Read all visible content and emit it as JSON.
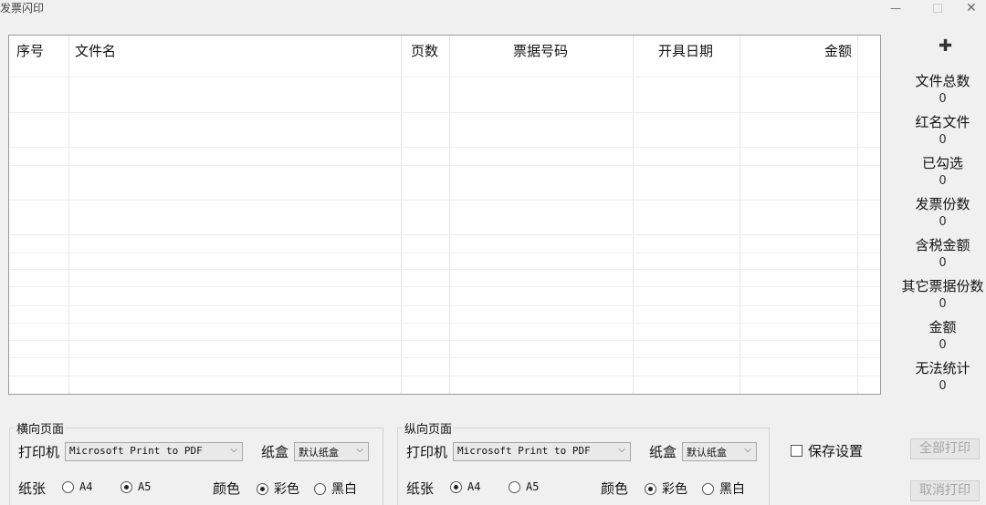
{
  "window": {
    "title": "发票闪印",
    "minimize": "—",
    "close": "✕"
  },
  "grid": {
    "columns": [
      "序号",
      "文件名",
      "页数",
      "票据号码",
      "开具日期",
      "金额"
    ]
  },
  "toolbar": {
    "add_icon": "plus-icon",
    "add_glyph": "✚"
  },
  "stats": [
    {
      "label": "文件总数",
      "value": "0"
    },
    {
      "label": "红名文件",
      "value": "0"
    },
    {
      "label": "已勾选",
      "value": "0"
    },
    {
      "label": "发票份数",
      "value": "0"
    },
    {
      "label": "含税金额",
      "value": "0"
    },
    {
      "label": "其它票据份数",
      "value": "0"
    },
    {
      "label": "金额",
      "value": "0"
    },
    {
      "label": "无法统计",
      "value": "0"
    }
  ],
  "landscape": {
    "title": "横向页面",
    "printer_label": "打印机",
    "printer_value": "Microsoft Print to PDF",
    "tray_label": "纸盒",
    "tray_value": "默认纸盒",
    "paper_label": "纸张",
    "paper_a4": "A4",
    "paper_a5": "A5",
    "paper_selected": "A5",
    "color_label": "颜色",
    "color_color": "彩色",
    "color_bw": "黑白",
    "color_selected": "彩色"
  },
  "portrait": {
    "title": "纵向页面",
    "printer_label": "打印机",
    "printer_value": "Microsoft Print to PDF",
    "tray_label": "纸盒",
    "tray_value": "默认纸盒",
    "paper_label": "纸张",
    "paper_a4": "A4",
    "paper_a5": "A5",
    "paper_selected": "A4",
    "color_label": "颜色",
    "color_color": "彩色",
    "color_bw": "黑白",
    "color_selected": "彩色"
  },
  "save_settings": {
    "label": "保存设置",
    "checked": false
  },
  "buttons": {
    "print_all": "全部打印",
    "cancel_print": "取消打印"
  },
  "colors": {
    "disabled_text": "#a5a5a5",
    "background": "#f0f0f0"
  }
}
